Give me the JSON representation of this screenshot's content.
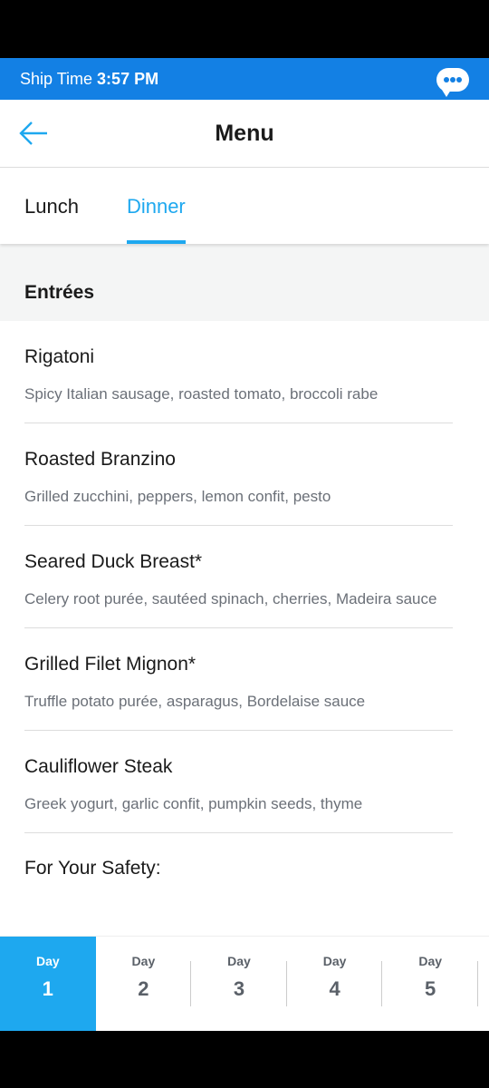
{
  "status": {
    "label": "Ship Time",
    "time": "3:57 PM"
  },
  "header": {
    "title": "Menu"
  },
  "tabs": [
    {
      "label": "Lunch"
    },
    {
      "label": "Dinner"
    }
  ],
  "section": "Entrées",
  "items": [
    {
      "name": "Rigatoni",
      "desc": "Spicy Italian sausage, roasted tomato, broccoli rabe"
    },
    {
      "name": "Roasted Branzino",
      "desc": "Grilled zucchini, peppers, lemon confit, pesto"
    },
    {
      "name": "Seared Duck Breast*",
      "desc": "Celery root purée, sautéed spinach, cherries, Madeira sauce"
    },
    {
      "name": "Grilled Filet Mignon*",
      "desc": "Truffle potato purée, asparagus, Bordelaise sauce"
    },
    {
      "name": "Cauliflower Steak",
      "desc": "Greek yogurt, garlic confit, pumpkin seeds, thyme"
    }
  ],
  "safety": "For Your Safety:",
  "days": [
    {
      "label": "Day",
      "num": "1"
    },
    {
      "label": "Day",
      "num": "2"
    },
    {
      "label": "Day",
      "num": "3"
    },
    {
      "label": "Day",
      "num": "4"
    },
    {
      "label": "Day",
      "num": "5"
    }
  ]
}
